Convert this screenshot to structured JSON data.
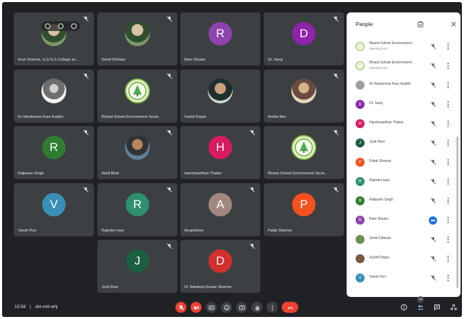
{
  "tiles": [
    {
      "name": "Arun Sharma, S.G.G.S College se..."
    },
    {
      "name": "Smriti Dhiman"
    },
    {
      "name": "Ram Shyam",
      "initial": "R",
      "color": "#8e44ad"
    },
    {
      "name": "Dr. Saroj",
      "initial": "D",
      "color": "#8e24aa"
    },
    {
      "name": "Dr Harshmran Kaur Aulakh"
    },
    {
      "name": "Bharat Suhavi Environment Socie..."
    },
    {
      "name": "Sushil Dogra"
    },
    {
      "name": "Ankita Mor"
    },
    {
      "name": "Rajkaran Singh",
      "initial": "R",
      "color": "#2e7d32"
    },
    {
      "name": "Aahil Bhat"
    },
    {
      "name": "Harshwardhan Thakur",
      "initial": "H",
      "color": "#d81b60"
    },
    {
      "name": "Bharat Suhavi Environment Socie..."
    },
    {
      "name": "Vansh Puri",
      "initial": "V",
      "color": "#3a8fb7"
    },
    {
      "name": "Rajinder kaur",
      "initial": "R",
      "color": "#2f8f6f"
    },
    {
      "name": "Anupriksha",
      "initial": "A",
      "color": "#a1887f"
    },
    {
      "name": "Palak Sharma",
      "initial": "P",
      "color": "#f4511e"
    },
    {
      "name": "Jyoti Rani",
      "initial": "J",
      "color": "#1b5e40"
    },
    {
      "name": "Dr Sandeep Kumar Sharma",
      "initial": "D",
      "color": "#d32f2f"
    }
  ],
  "bottom": {
    "time": "15:58",
    "separator": "|",
    "meeting_code": "cbt-vnti-whj",
    "participant_count": "18"
  },
  "people": {
    "title": "People",
    "rows": [
      {
        "name": "Bharat Suhavi Environment...",
        "sub": "Meeting host"
      },
      {
        "name": "Bharat Suhavi Environment...",
        "sub": "Meeting host"
      },
      {
        "name": "Dr Harshmran Kaur Aulakh"
      },
      {
        "name": "Dr. Saroj",
        "initial": "D",
        "color": "#8e24aa"
      },
      {
        "name": "Harshwardhan Thakur",
        "initial": "H",
        "color": "#d81b60"
      },
      {
        "name": "Jyoti Rani",
        "initial": "J",
        "color": "#1b5e40"
      },
      {
        "name": "Palak Sharma",
        "initial": "P",
        "color": "#f4511e"
      },
      {
        "name": "Rajinder kaur",
        "initial": "R",
        "color": "#2f8f6f"
      },
      {
        "name": "Rajkaran Singh",
        "initial": "R",
        "color": "#2e7d32"
      },
      {
        "name": "Ram Shyam",
        "initial": "R",
        "color": "#8e44ad"
      },
      {
        "name": "Smriti Dhiman"
      },
      {
        "name": "Sushil Dogra"
      },
      {
        "name": "Vansh Puri",
        "initial": "V",
        "color": "#3a8fb7"
      }
    ]
  }
}
